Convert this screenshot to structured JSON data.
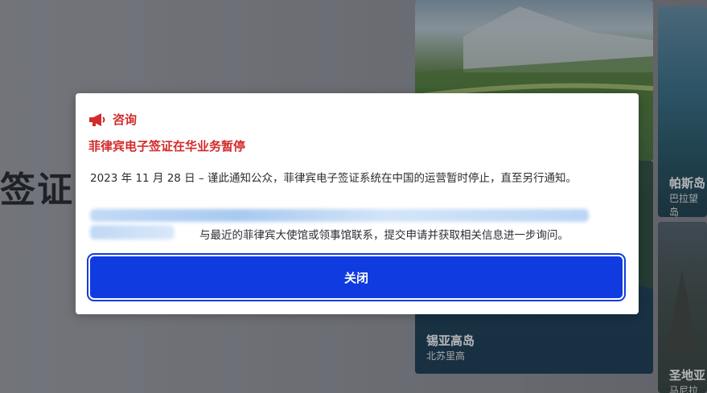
{
  "page": {
    "hero_title": "签证"
  },
  "cards": [
    {
      "name": "锡亚高岛",
      "sub": "北苏里高"
    },
    {
      "name": "帕斯岛",
      "sub": "巴拉望岛"
    },
    {
      "name": "圣地亚",
      "sub": "马尼拉市"
    }
  ],
  "modal": {
    "head_label": "咨询",
    "title": "菲律宾电子签证在华业务暂停",
    "body": "2023 年 11 月 28 日 – 谨此通知公众，菲律宾电子签证系统在中国的运营暂时停止，直至另行通知。",
    "body_tail": "与最近的菲律宾大使馆或领事馆联系，提交申请并获取相关信息进一步询问。",
    "close_label": "关闭",
    "accent_color": "#d22b2b",
    "button_color": "#0f3be0"
  }
}
